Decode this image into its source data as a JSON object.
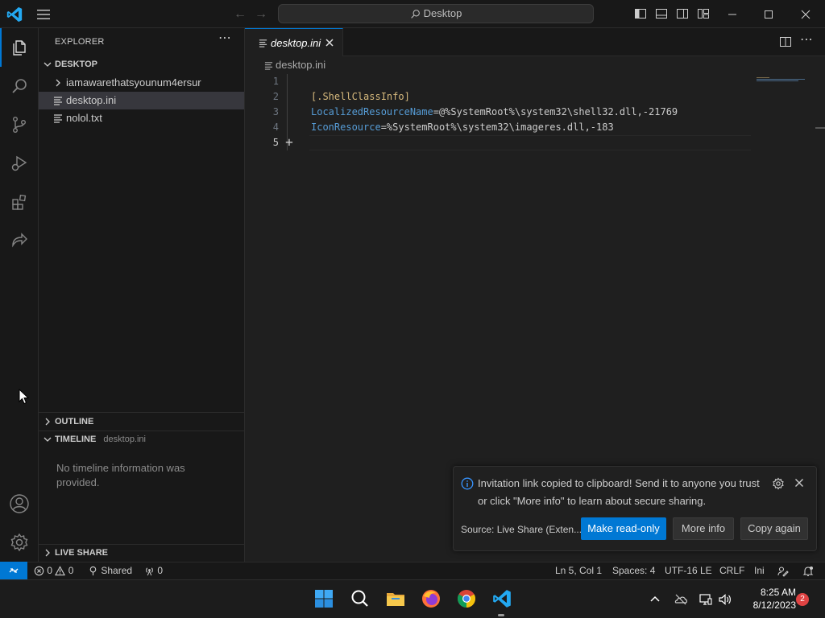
{
  "titlebar": {
    "search_text": "Desktop",
    "colors": {
      "vscode_blue": "#23a9f2"
    }
  },
  "activitybar": {
    "items": [
      {
        "name": "explorer",
        "icon": "files-icon",
        "active": true
      },
      {
        "name": "search",
        "icon": "search-icon"
      },
      {
        "name": "source-control",
        "icon": "source-control-icon"
      },
      {
        "name": "run-debug",
        "icon": "run-debug-icon"
      },
      {
        "name": "extensions",
        "icon": "extensions-icon"
      },
      {
        "name": "live-share",
        "icon": "live-share-icon"
      }
    ],
    "bottom": [
      {
        "name": "accounts",
        "icon": "account-icon"
      },
      {
        "name": "manage",
        "icon": "gear-icon"
      }
    ]
  },
  "sidebar": {
    "title": "EXPLORER",
    "folder": "DESKTOP",
    "files": [
      {
        "label": "iamawarethatsyounum4ersur",
        "type": "folder"
      },
      {
        "label": "desktop.ini",
        "type": "file",
        "selected": true
      },
      {
        "label": "nolol.txt",
        "type": "file"
      }
    ],
    "outline": "OUTLINE",
    "timeline": {
      "title": "TIMELINE",
      "file": "desktop.ini",
      "empty": "No timeline information was provided."
    },
    "live_share": "LIVE SHARE"
  },
  "editor": {
    "tab_label": "desktop.ini",
    "breadcrumb": "desktop.ini",
    "lines": [
      {
        "num": "1",
        "section": "",
        "key": "",
        "value": ""
      },
      {
        "num": "2",
        "section": "[.ShellClassInfo]",
        "key": "",
        "value": ""
      },
      {
        "num": "3",
        "section": "",
        "key": "LocalizedResourceName",
        "value": "=@%SystemRoot%\\system32\\shell32.dll,-21769"
      },
      {
        "num": "4",
        "section": "",
        "key": "IconResource",
        "value": "=%SystemRoot%\\system32\\imageres.dll,-183"
      },
      {
        "num": "5",
        "section": "",
        "key": "",
        "value": ""
      }
    ],
    "current_line": "5"
  },
  "notification": {
    "message": "Invitation link copied to clipboard! Send it to anyone you trust or click \"More info\" to learn about secure sharing.",
    "source": "Source: Live Share (Exten...",
    "buttons": {
      "primary": "Make read-only",
      "more_info": "More info",
      "copy_again": "Copy again"
    }
  },
  "statusbar": {
    "errors": "0",
    "warnings": "0",
    "shared": "Shared",
    "ports": "0",
    "position": "Ln 5, Col 1",
    "spaces": "Spaces: 4",
    "encoding": "UTF-16 LE",
    "eol": "CRLF",
    "language": "Ini"
  },
  "taskbar": {
    "apps": [
      "start-icon",
      "search-icon",
      "file-explorer-icon",
      "firefox-icon",
      "chrome-icon",
      "vscode-icon"
    ],
    "time": "8:25 AM",
    "date": "8/12/2023",
    "notifications": "2"
  }
}
